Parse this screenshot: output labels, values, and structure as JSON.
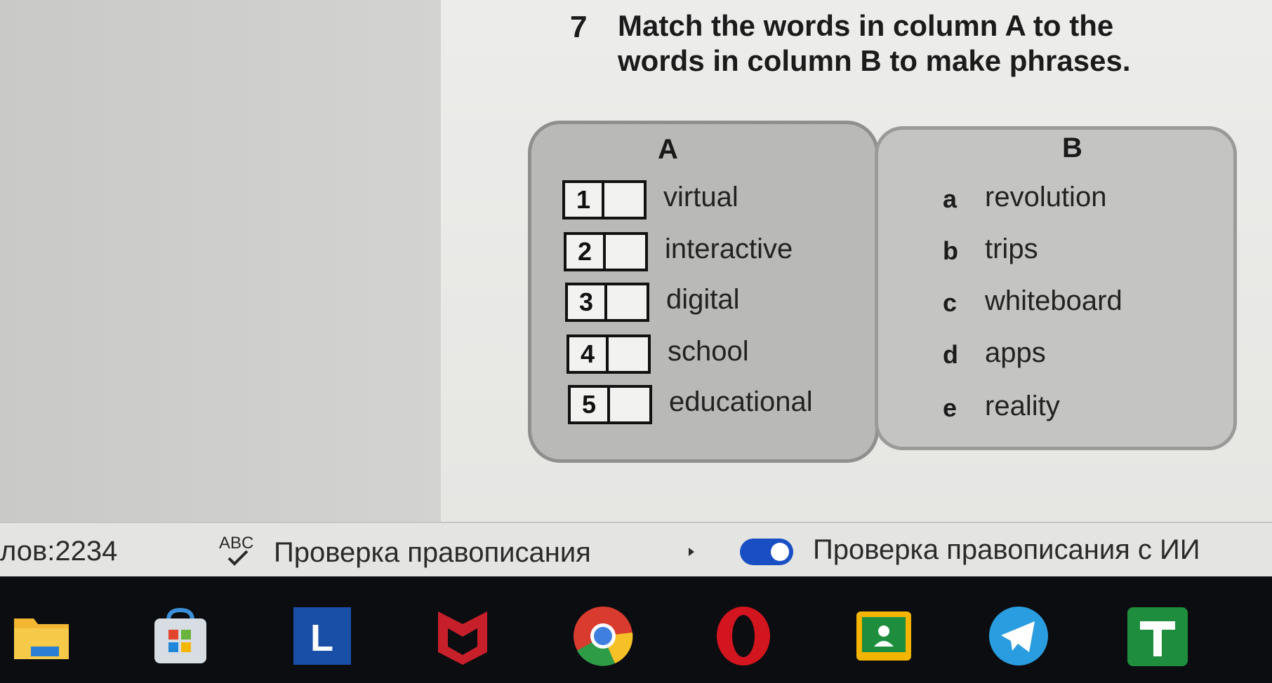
{
  "exercise": {
    "number": "7",
    "title_line1": "Match the words in column A to the",
    "title_line2": "words in column B to make phrases."
  },
  "column_a": {
    "heading": "A",
    "items": [
      {
        "number": "1",
        "word": "virtual"
      },
      {
        "number": "2",
        "word": "interactive"
      },
      {
        "number": "3",
        "word": "digital"
      },
      {
        "number": "4",
        "word": "school"
      },
      {
        "number": "5",
        "word": "educational"
      }
    ]
  },
  "column_b": {
    "heading": "B",
    "items": [
      {
        "letter": "a",
        "word": "revolution"
      },
      {
        "letter": "b",
        "word": "trips"
      },
      {
        "letter": "c",
        "word": "whiteboard"
      },
      {
        "letter": "d",
        "word": "apps"
      },
      {
        "letter": "e",
        "word": "reality"
      }
    ]
  },
  "statusbar": {
    "word_count": "лов:2234",
    "spell_check_label": "Проверка правописания",
    "ai_spell_check_label": "Проверка правописания с ИИ",
    "ai_toggle_on": true,
    "toggle_color": "#1a4fc4"
  },
  "taskbar": {
    "icons": [
      "file-explorer-icon",
      "microsoft-store-icon",
      "lingvo-icon",
      "mcafee-icon",
      "chrome-icon",
      "opera-icon",
      "google-classroom-icon",
      "telegram-icon",
      "google-sheets-icon"
    ]
  }
}
